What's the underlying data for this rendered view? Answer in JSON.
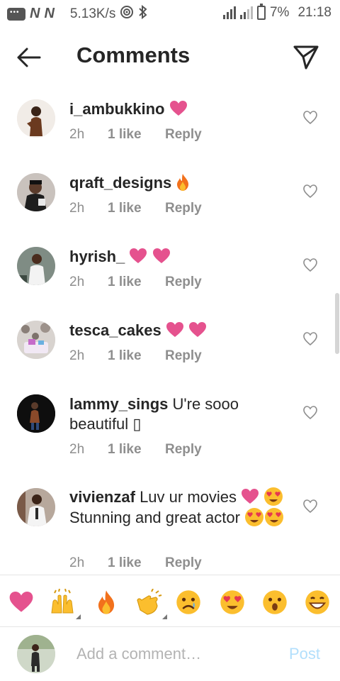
{
  "status_bar": {
    "carrier_icons": [
      "chat-icon",
      "n-icon",
      "n-icon"
    ],
    "n_label": "N",
    "net_speed": "5.13K/s",
    "battery": "7%",
    "time": "21:18"
  },
  "header": {
    "title": "Comments",
    "back_icon": "arrow-left-icon",
    "send_icon": "paper-plane-icon"
  },
  "comments": [
    {
      "username": "i_ambukkino",
      "text": "",
      "emojis": [
        "heart"
      ],
      "time": "2h",
      "likes": "1 like",
      "reply": "Reply"
    },
    {
      "username": "qraft_designs",
      "text": "",
      "emojis": [
        "fire"
      ],
      "time": "2h",
      "likes": "1 like",
      "reply": "Reply"
    },
    {
      "username": "hyrish_",
      "text": "",
      "emojis": [
        "heart",
        "heart"
      ],
      "time": "2h",
      "likes": "1 like",
      "reply": "Reply"
    },
    {
      "username": "tesca_cakes",
      "text": "",
      "emojis": [
        "heart",
        "heart"
      ],
      "time": "2h",
      "likes": "1 like",
      "reply": "Reply"
    },
    {
      "username": "lammy_sings",
      "text": "U're sooo beautiful",
      "trailing": "▯",
      "time": "2h",
      "likes": "1 like",
      "reply": "Reply"
    },
    {
      "username": "vivienzaf",
      "text": "Luv ur movies",
      "text2": "Stunning and great actor",
      "time": "2h",
      "likes": "1 like",
      "reply": "Reply"
    }
  ],
  "emoji_bar": [
    "heart",
    "raised-hands",
    "fire",
    "clapping-hands",
    "sad-face",
    "heart-eyes",
    "surprised-face",
    "grinning-face"
  ],
  "add_comment": {
    "placeholder": "Add a comment…",
    "post_label": "Post"
  },
  "colors": {
    "heart": "#e5528e",
    "post_disabled": "#b2dffc",
    "meta_gray": "#8e8e8e",
    "emoji_yellow": "#fbbe2e"
  }
}
